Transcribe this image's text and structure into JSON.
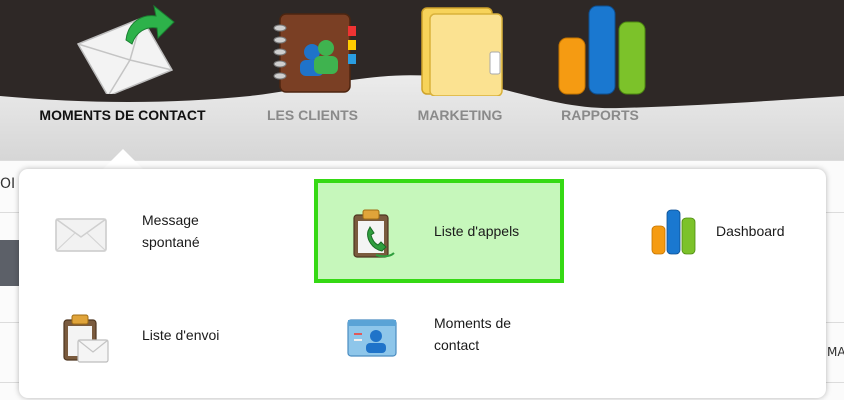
{
  "nav": {
    "items": [
      {
        "label": "MOMENTS DE CONTACT",
        "active": true,
        "icon": "envelope-arrow-icon"
      },
      {
        "label": "LES CLIENTS",
        "active": false,
        "icon": "address-book-icon"
      },
      {
        "label": "MARKETING",
        "active": false,
        "icon": "folder-icon"
      },
      {
        "label": "RAPPORTS",
        "active": false,
        "icon": "bar-chart-icon"
      }
    ]
  },
  "dropdown": {
    "items": [
      {
        "label": "Message\nspontané",
        "icon": "envelope-icon"
      },
      {
        "label": "Liste d'appels",
        "icon": "phone-clipboard-icon",
        "highlighted": true
      },
      {
        "label": "Dashboard",
        "icon": "bar-chart-icon"
      },
      {
        "label": "Liste d'envoi",
        "icon": "mail-clipboard-icon"
      },
      {
        "label": "Moments de\ncontact",
        "icon": "contact-card-icon"
      }
    ]
  },
  "background": {
    "left_text": "OI",
    "right_text": "MA"
  },
  "colors": {
    "header_dark": "#2e2826",
    "highlight_fill": "#c6f7bb",
    "highlight_border": "#35d914",
    "nav_active": "#111111",
    "nav_inactive": "#8a8a8a"
  }
}
